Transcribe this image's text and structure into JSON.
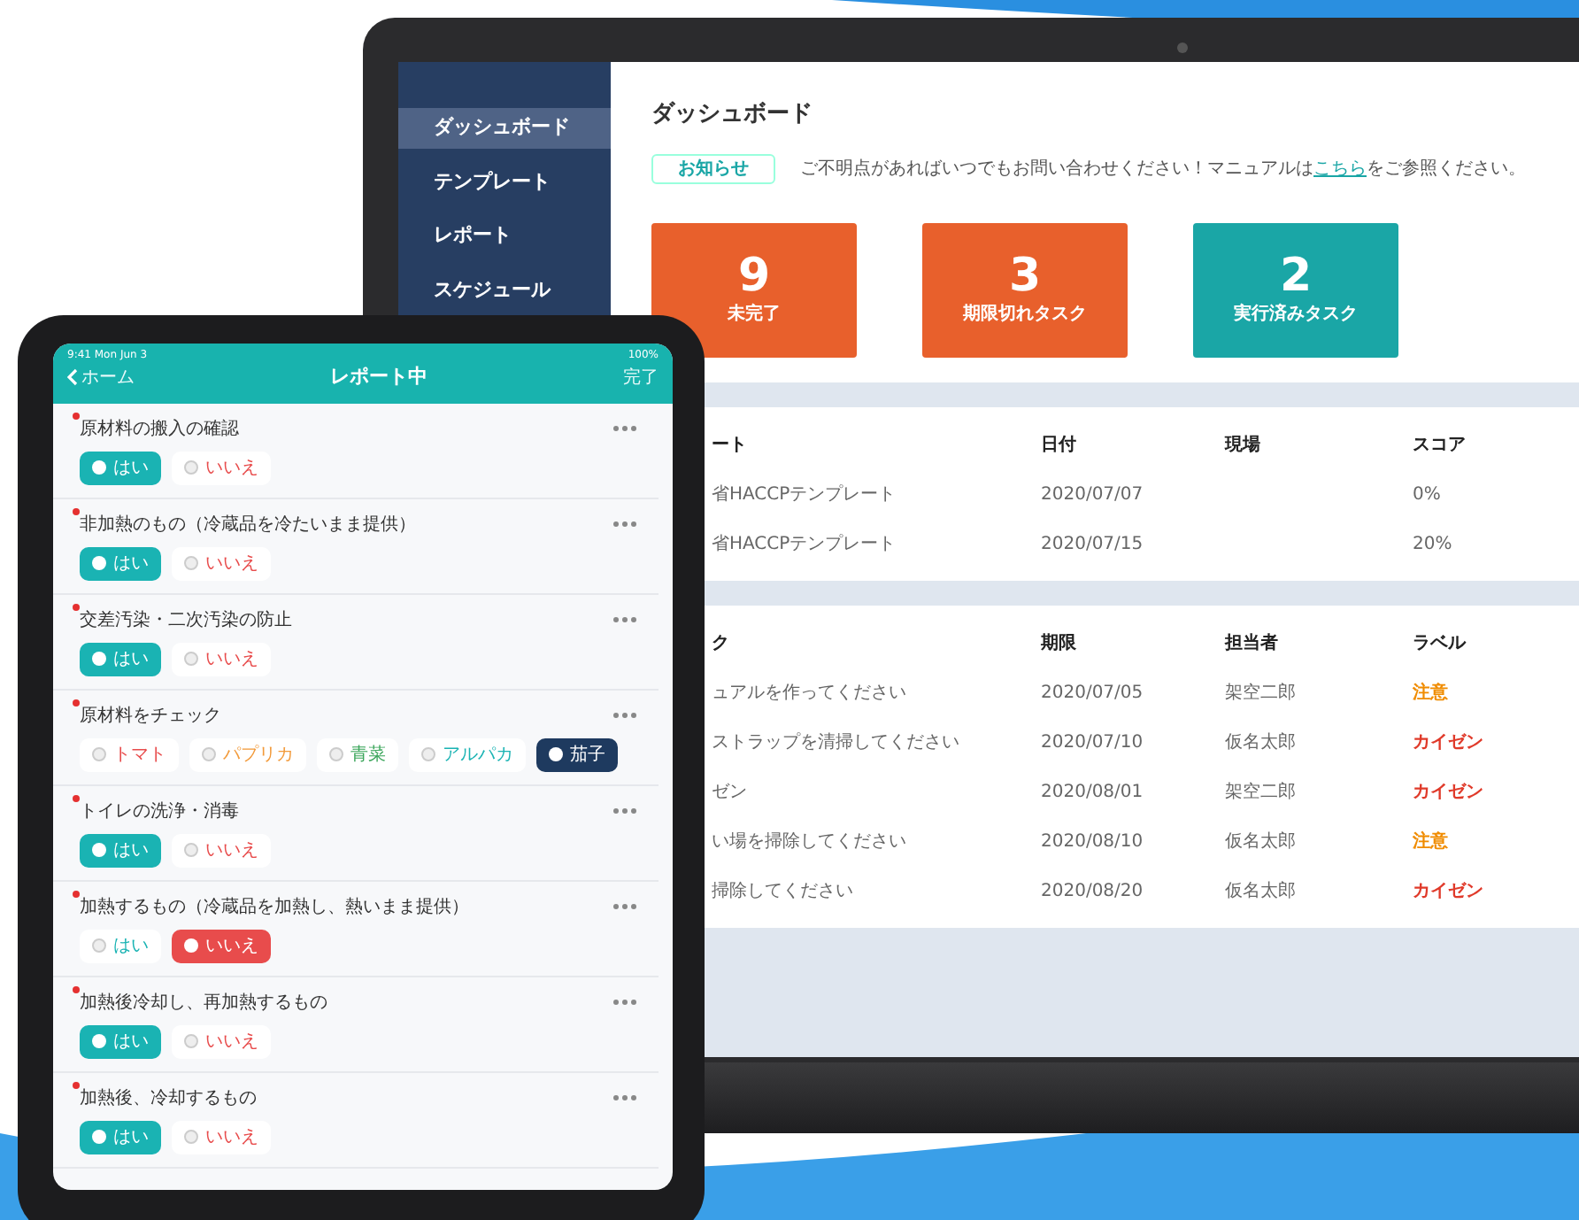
{
  "laptop": {
    "sidebar": {
      "items": [
        {
          "label": "ダッシュボード",
          "selected": true
        },
        {
          "label": "テンプレート",
          "selected": false
        },
        {
          "label": "レポート",
          "selected": false
        },
        {
          "label": "スケジュール",
          "selected": false
        }
      ]
    },
    "title": "ダッシュボード",
    "notice": {
      "badge": "お知らせ",
      "text_before": "ご不明点があればいつでもお問い合わせください！マニュアルは",
      "link": "こちら",
      "text_after": "をご参照ください。"
    },
    "cards": [
      {
        "value": "9",
        "label": "未完了",
        "color": "#e8602c"
      },
      {
        "value": "3",
        "label": "期限切れタスク",
        "color": "#e8602c"
      },
      {
        "value": "2",
        "label": "実行済みタスク",
        "color": "#1aa6a6"
      }
    ],
    "reports": {
      "columns": [
        "ート",
        "日付",
        "現場",
        "スコア"
      ],
      "rows": [
        [
          "省HACCPテンプレート",
          "2020/07/07",
          "",
          "0%"
        ],
        [
          "省HACCPテンプレート",
          "2020/07/15",
          "",
          "20%"
        ]
      ]
    },
    "tasks": {
      "columns": [
        "ク",
        "期限",
        "担当者",
        "ラベル"
      ],
      "rows": [
        {
          "task": "ュアルを作ってください",
          "due": "2020/07/05",
          "assignee": "架空二郎",
          "label": "注意",
          "color": "#f08c00"
        },
        {
          "task": "ストラップを清掃してください",
          "due": "2020/07/10",
          "assignee": "仮名太郎",
          "label": "カイゼン",
          "color": "#e03a2a"
        },
        {
          "task": "ゼン",
          "due": "2020/08/01",
          "assignee": "架空二郎",
          "label": "カイゼン",
          "color": "#e03a2a"
        },
        {
          "task": "い場を掃除してください",
          "due": "2020/08/10",
          "assignee": "仮名太郎",
          "label": "注意",
          "color": "#f08c00"
        },
        {
          "task": "掃除してください",
          "due": "2020/08/20",
          "assignee": "仮名太郎",
          "label": "カイゼン",
          "color": "#e03a2a"
        }
      ]
    }
  },
  "tablet": {
    "status_time": "9:41 Mon Jun 3",
    "status_battery": "100%",
    "back": "ホーム",
    "title": "レポート中",
    "done": "完了",
    "items": [
      {
        "title": "原材料の搬入の確認",
        "required": true,
        "options": [
          {
            "label": "はい",
            "selected": true,
            "color": "#1ab3b3"
          },
          {
            "label": "いいえ",
            "selected": false,
            "color": "#e84c4c"
          }
        ]
      },
      {
        "title": "非加熱のもの（冷蔵品を冷たいまま提供）",
        "required": true,
        "options": [
          {
            "label": "はい",
            "selected": true,
            "color": "#1ab3b3"
          },
          {
            "label": "いいえ",
            "selected": false,
            "color": "#e84c4c"
          }
        ]
      },
      {
        "title": "交差汚染・二次汚染の防止",
        "required": true,
        "options": [
          {
            "label": "はい",
            "selected": true,
            "color": "#1ab3b3"
          },
          {
            "label": "いいえ",
            "selected": false,
            "color": "#e84c4c"
          }
        ]
      },
      {
        "title": "原材料をチェック",
        "required": true,
        "options": [
          {
            "label": "トマト",
            "selected": false,
            "color": "#e84c4c"
          },
          {
            "label": "パプリカ",
            "selected": false,
            "color": "#f29a3a"
          },
          {
            "label": "青菜",
            "selected": false,
            "color": "#3aa55a"
          },
          {
            "label": "アルパカ",
            "selected": false,
            "color": "#1ab3b3"
          },
          {
            "label": "茄子",
            "selected": true,
            "color": "#1e3a5f"
          }
        ]
      },
      {
        "title": "トイレの洗浄・消毒",
        "required": true,
        "options": [
          {
            "label": "はい",
            "selected": true,
            "color": "#1ab3b3"
          },
          {
            "label": "いいえ",
            "selected": false,
            "color": "#e84c4c"
          }
        ]
      },
      {
        "title": "加熱するもの（冷蔵品を加熱し、熱いまま提供）",
        "required": true,
        "options": [
          {
            "label": "はい",
            "selected": false,
            "color": "#1ab3b3"
          },
          {
            "label": "いいえ",
            "selected": true,
            "color": "#e84c4c"
          }
        ]
      },
      {
        "title": "加熱後冷却し、再加熱するもの",
        "required": true,
        "options": [
          {
            "label": "はい",
            "selected": true,
            "color": "#1ab3b3"
          },
          {
            "label": "いいえ",
            "selected": false,
            "color": "#e84c4c"
          }
        ]
      },
      {
        "title": "加熱後、冷却するもの",
        "required": true,
        "options": [
          {
            "label": "はい",
            "selected": true,
            "color": "#1ab3b3"
          },
          {
            "label": "いいえ",
            "selected": false,
            "color": "#e84c4c"
          }
        ]
      }
    ]
  }
}
